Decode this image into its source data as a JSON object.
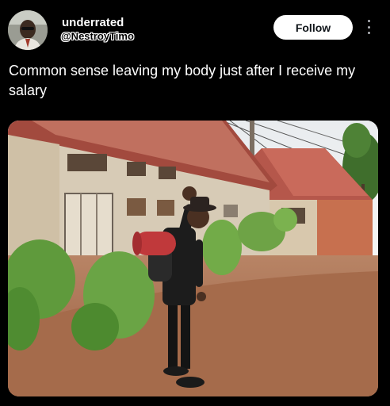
{
  "author": {
    "display_name": "underrated",
    "handle": "@NestroyTimo",
    "avatar_icon": "profile-photo"
  },
  "follow_button": {
    "label": "Follow"
  },
  "more_menu": {
    "icon": "more-vertical-icon"
  },
  "tweet": {
    "text": "Common sense leaving my body just after I receive my salary"
  },
  "media": {
    "type": "photo",
    "icon": "photo-man-waving-with-backpack"
  },
  "colors": {
    "background": "#000000",
    "text": "#ffffff",
    "follow_bg": "#ffffff",
    "follow_text": "#0f1419"
  }
}
